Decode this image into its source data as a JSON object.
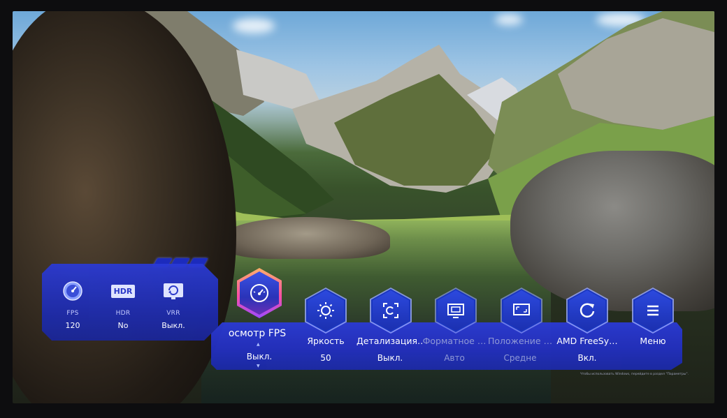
{
  "stats_panel": {
    "items": [
      {
        "label": "FPS",
        "value": "120",
        "icon": "speedometer-icon"
      },
      {
        "label": "HDR",
        "value": "No",
        "icon": "hdr-icon",
        "icon_text": "HDR"
      },
      {
        "label": "VRR",
        "value": "Выкл.",
        "icon": "vrr-icon"
      }
    ]
  },
  "menu": {
    "items": [
      {
        "label": "осмотр FPS",
        "value": "Выкл.",
        "icon": "fps-gauge-icon",
        "state": "selected"
      },
      {
        "label": "Яркость",
        "value": "50",
        "icon": "brightness-icon",
        "state": "active"
      },
      {
        "label": "Детализация…",
        "value": "Выкл.",
        "icon": "detail-focus-icon",
        "state": "active"
      },
      {
        "label": "Форматное …",
        "value": "Авто",
        "icon": "screen-format-icon",
        "state": "disabled"
      },
      {
        "label": "Положение …",
        "value": "Средне",
        "icon": "screen-position-icon",
        "state": "disabled"
      },
      {
        "label": "AMD FreeSy…",
        "value": "Вкл.",
        "icon": "freesync-refresh-icon",
        "state": "active"
      },
      {
        "label": "Меню",
        "value": "",
        "icon": "menu-hamburger-icon",
        "state": "active"
      }
    ]
  },
  "fine_print": "Чтобы использовать Windows, перейдите в раздел \"Параметры\".",
  "colors": {
    "panel_blue": "#2330c1",
    "selected_gradient_top": "#ffb06a",
    "selected_gradient_bottom": "#9a4bff",
    "disabled_text": "#8f98d6"
  }
}
